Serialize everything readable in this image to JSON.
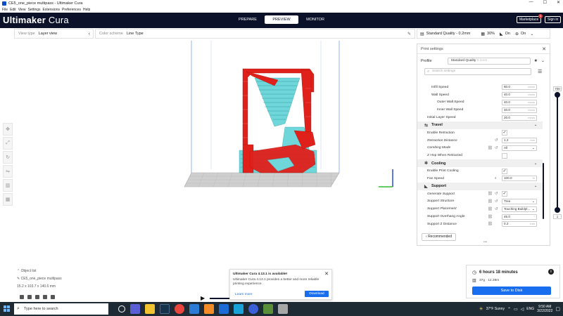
{
  "window": {
    "title": "CE5_one_piece multipass - Ultimaker Cura",
    "controls": [
      "—",
      "☐",
      "✕"
    ]
  },
  "menu": [
    "File",
    "Edit",
    "View",
    "Settings",
    "Extensions",
    "Preferences",
    "Help"
  ],
  "header": {
    "logo_brand": "Ultimaker",
    "logo_product": "Cura",
    "stages": [
      "PREPARE",
      "PREVIEW",
      "MONITOR"
    ],
    "active_stage": "PREVIEW",
    "marketplace": "Marketplace",
    "notification_count": "1",
    "sign_in": "Sign in"
  },
  "toolbar": {
    "view_type_label": "View type",
    "view_type_value": "Layer view",
    "color_scheme_label": "Color scheme",
    "color_scheme_value": "Line Type",
    "quality": "Standard Quality - 0.2mm",
    "infill": "30%",
    "support": "On",
    "adhesion": "On"
  },
  "print_settings": {
    "title": "Print settings",
    "profile_label": "Profile",
    "profile_value": "Standard Quality",
    "profile_sub": "0.2mm",
    "search_placeholder": "Search settings",
    "rows": [
      {
        "type": "setting",
        "indent": 1,
        "name": "Infill Speed",
        "value": "60.0",
        "unit": "mm/s"
      },
      {
        "type": "setting",
        "indent": 1,
        "name": "Wall Speed",
        "value": "40.0",
        "unit": "mm/s"
      },
      {
        "type": "setting",
        "indent": 2,
        "name": "Outer Wall Speed",
        "value": "40.0",
        "unit": "mm/s"
      },
      {
        "type": "setting",
        "indent": 2,
        "name": "Inner Wall Speed",
        "value": "40.0",
        "unit": "mm/s"
      },
      {
        "type": "setting",
        "indent": 0,
        "name": "Initial Layer Speed",
        "value": "20.0",
        "unit": "mm/s"
      },
      {
        "type": "category",
        "name": "Travel",
        "icon": "travel-icon",
        "glyph": "⇆"
      },
      {
        "type": "check",
        "indent": 0,
        "name": "Enable Retraction",
        "checked": true
      },
      {
        "type": "setting",
        "indent": 0,
        "name": "Retraction Distance",
        "value": "1.2",
        "unit": "mm",
        "italic": true,
        "reset": true
      },
      {
        "type": "dropdown",
        "indent": 0,
        "name": "Combing Mode",
        "value": "All",
        "italic": true,
        "link": true,
        "reset": true
      },
      {
        "type": "check",
        "indent": 0,
        "name": "Z Hop When Retracted",
        "checked": false
      },
      {
        "type": "category",
        "name": "Cooling",
        "icon": "cooling-fan-icon",
        "glyph": "✻"
      },
      {
        "type": "check",
        "indent": 0,
        "name": "Enable Print Cooling",
        "checked": true
      },
      {
        "type": "setting",
        "indent": 0,
        "name": "Fan Speed",
        "value": "100.0",
        "unit": "%",
        "func": true
      },
      {
        "type": "category",
        "name": "Support",
        "icon": "support-icon",
        "glyph": "◣"
      },
      {
        "type": "check",
        "indent": 0,
        "name": "Generate Support",
        "checked": true,
        "italic": true,
        "link": true,
        "reset": true
      },
      {
        "type": "dropdown",
        "indent": 0,
        "name": "Support Structure",
        "value": "Tree",
        "italic": true,
        "link": true,
        "reset": true
      },
      {
        "type": "dropdown",
        "indent": 0,
        "name": "Support Placement",
        "value": "Touching Buildpl...",
        "italic": true,
        "link": true,
        "reset": true
      },
      {
        "type": "setting",
        "indent": 0,
        "name": "Support Overhang Angle",
        "value": "45.0",
        "unit": "°",
        "link": true
      },
      {
        "type": "setting",
        "indent": 0,
        "name": "Support Z Distance",
        "value": "0.2",
        "unit": "mm",
        "link": true
      }
    ],
    "recommended": "Recommended"
  },
  "layer_slider": {
    "top_value": "700",
    "bottom_value": "1"
  },
  "object_list": {
    "label": "Object list",
    "file": "CE5_one_piece multipass",
    "dimensions": "15.2 x 103.7 x 140.6 mm"
  },
  "notification": {
    "title": "Ultimaker Cura 4.13.1 is available!",
    "body": "Ultimaker Cura 4.13.1 provides a better and more reliable printing experience.",
    "learn_more": "Learn more",
    "download": "Download"
  },
  "estimate": {
    "time": "6 hours 18 minutes",
    "material": "37g · 12.39m",
    "save": "Save to Disk"
  },
  "taskbar": {
    "search_placeholder": "Type here to search",
    "weather": "37°F  Sunny",
    "lang": "ENG",
    "time": "9:50 AM",
    "date": "3/22/2022"
  },
  "colors": {
    "header_bg": "#0a1128",
    "accent": "#196ef0",
    "wall_red": "#e0201b",
    "support_cyan": "#6fd6da",
    "taskbar_bg": "#1e2b35"
  }
}
